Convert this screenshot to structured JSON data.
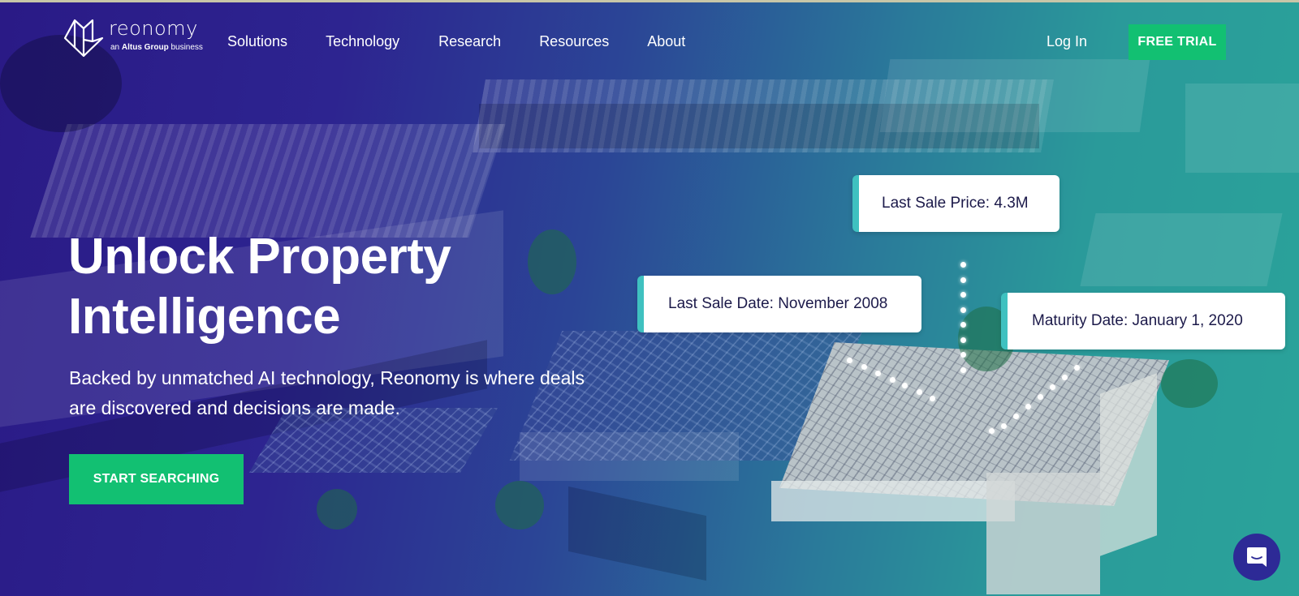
{
  "brand": {
    "name": "reonomy",
    "tagline_prefix": "an ",
    "tagline_bold": "Altus Group",
    "tagline_suffix": " business",
    "logo_icon": "cube-logo-icon"
  },
  "nav": {
    "items": [
      {
        "label": "Solutions"
      },
      {
        "label": "Technology"
      },
      {
        "label": "Research"
      },
      {
        "label": "Resources"
      },
      {
        "label": "About"
      }
    ],
    "login_label": "Log In",
    "trial_label": "FREE TRIAL"
  },
  "hero": {
    "headline_line1": "Unlock Property",
    "headline_line2": "Intelligence",
    "subtext": "Backed by unmatched AI technology, Reonomy is where deals are discovered and decisions are made.",
    "cta_label": "START SEARCHING"
  },
  "callouts": {
    "price": "Last Sale Price: 4.3M",
    "date": "Last Sale Date: November 2008",
    "maturity": "Maturity Date: January 1, 2020"
  },
  "chat": {
    "icon": "chat-bubble-icon"
  },
  "colors": {
    "accent_green": "#12c072",
    "overlay_purple": "#2a1a86",
    "overlay_teal": "#2aa39a",
    "card_accent": "#3fc1c0",
    "card_text": "#1c1a4a",
    "chat_bg": "#2d2a96"
  }
}
